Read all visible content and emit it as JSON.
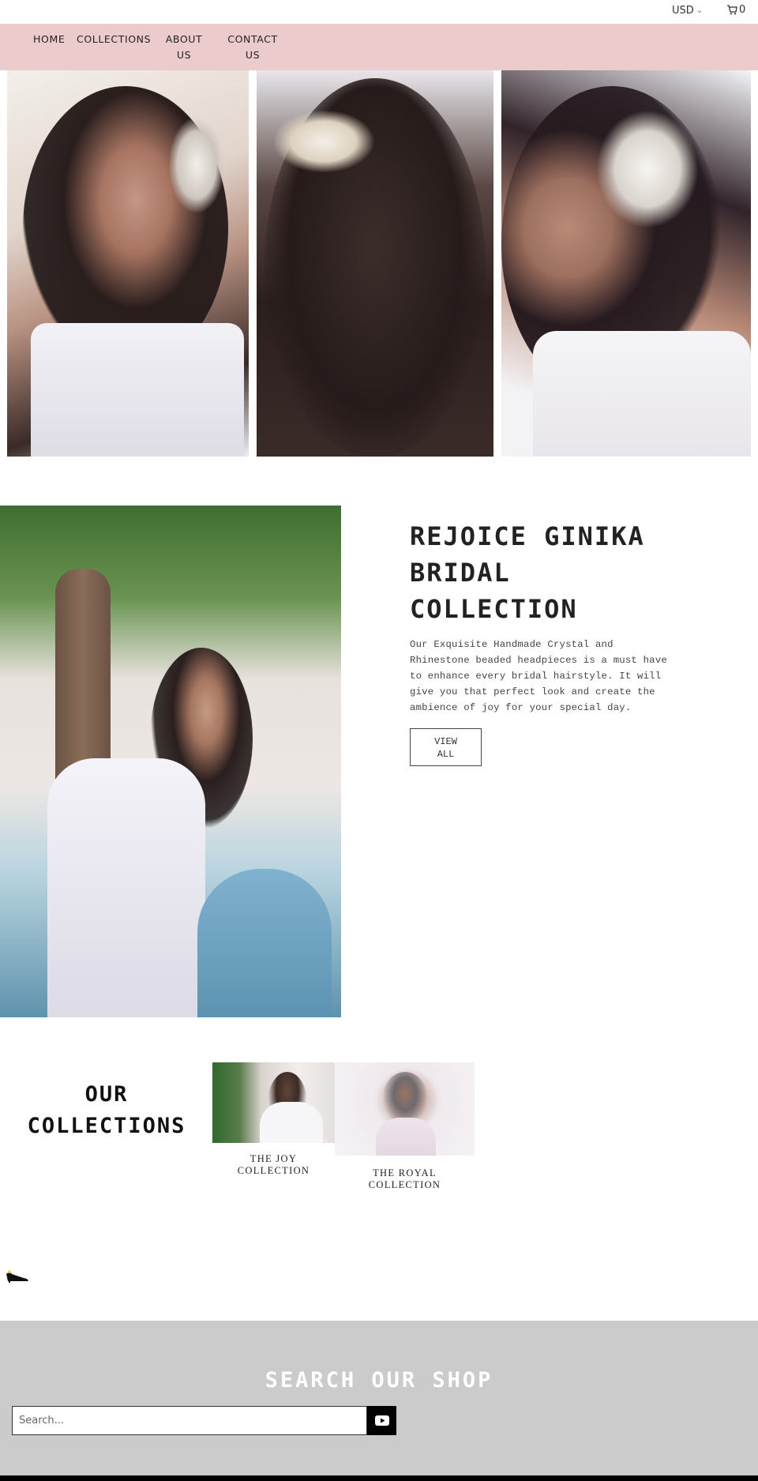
{
  "header": {
    "currency": "USD",
    "cart_count": "0"
  },
  "nav": {
    "home": "HOME",
    "collections": "COLLECTIONS",
    "about_line1": "ABOUT",
    "about_line2": "US",
    "contact_line1": "CONTACT",
    "contact_line2": "US"
  },
  "featured": {
    "title_line1": "REJOICE GINIKA",
    "title_line2": "BRIDAL",
    "title_line3": "COLLECTION",
    "description": "Our Exquisite Handmade Crystal and Rhinestone beaded headpieces is a must have to enhance every bridal hairstyle. It will give you that perfect look and create the ambience of joy for your special day.",
    "button_line1": "VIEW",
    "button_line2": "ALL"
  },
  "collections": {
    "title_line1": "OUR",
    "title_line2": "COLLECTIONS",
    "items": [
      {
        "line1": "THE JOY",
        "line2": "COLLECTION"
      },
      {
        "line1": "THE ROYAL",
        "line2": "COLLECTION"
      }
    ]
  },
  "search": {
    "title": "SEARCH OUR SHOP",
    "placeholder": "Search..."
  },
  "colors": {
    "nav_bg": "#eccbcc",
    "search_bg": "#cbcbcb",
    "footer_bar": "#000000"
  },
  "icons": [
    "chevron-down-icon",
    "cart-icon",
    "shoe-icon",
    "play-icon"
  ]
}
